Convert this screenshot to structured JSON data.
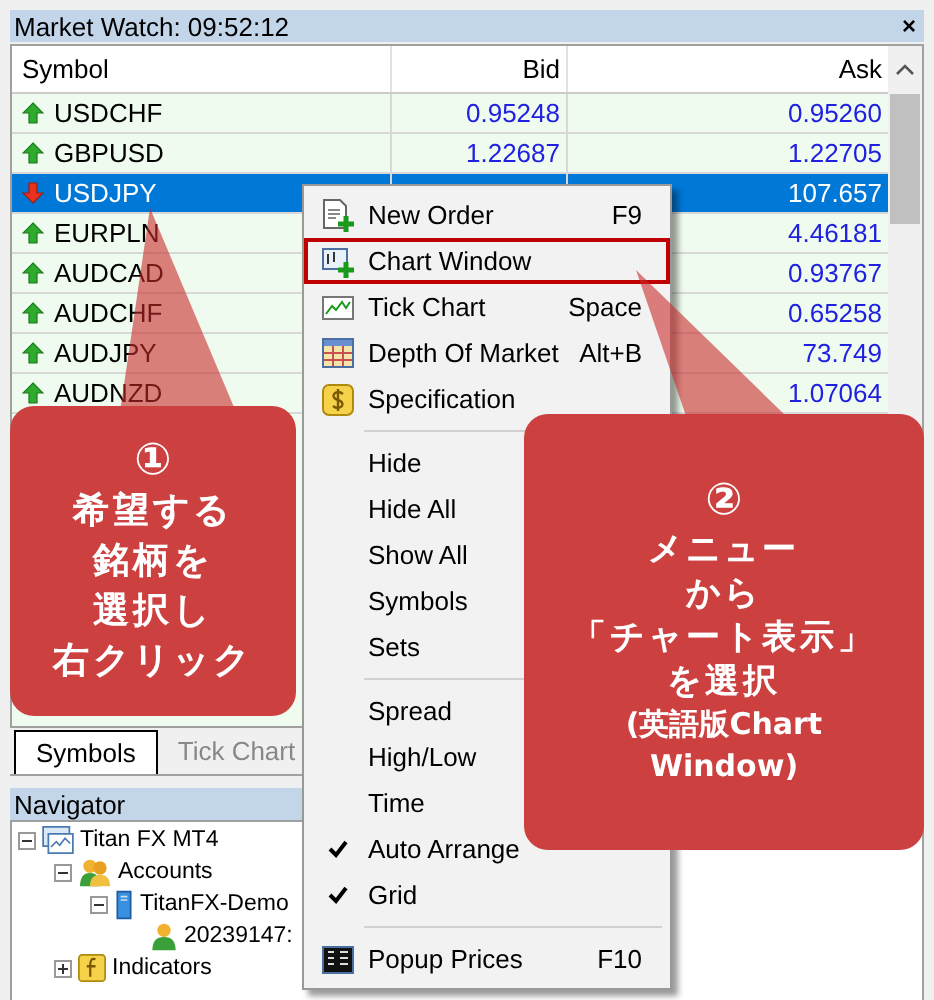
{
  "market_watch": {
    "title": "Market Watch: 09:52:12",
    "close": "×",
    "columns": [
      "Symbol",
      "Bid",
      "Ask"
    ],
    "rows": [
      {
        "symbol": "USDCHF",
        "kind": "up",
        "bid": "0.95248",
        "ask": "0.95260",
        "selected": false
      },
      {
        "symbol": "GBPUSD",
        "kind": "up",
        "bid": "1.22687",
        "ask": "1.22705",
        "selected": false
      },
      {
        "symbol": "USDJPY",
        "kind": "down",
        "ask": "107.657",
        "selected": true
      },
      {
        "symbol": "EURPLN",
        "kind": "up",
        "ask": "4.46181",
        "selected": false
      },
      {
        "symbol": "AUDCAD",
        "kind": "up",
        "ask": "0.93767",
        "selected": false
      },
      {
        "symbol": "AUDCHF",
        "kind": "up",
        "ask": "0.65258",
        "selected": false
      },
      {
        "symbol": "AUDJPY",
        "kind": "up",
        "ask": "73.749",
        "selected": false
      },
      {
        "symbol": "AUDNZD",
        "kind": "up",
        "ask": "1.07064",
        "selected": false
      }
    ],
    "tabs": [
      {
        "label": "Symbols",
        "selected": true
      },
      {
        "label": "Tick Chart",
        "selected": false
      }
    ]
  },
  "navigator": {
    "title": "Navigator",
    "tree": [
      {
        "label": "Titan FX MT4",
        "kind": "terminal",
        "expanded": true,
        "children": [
          {
            "label": "Accounts",
            "kind": "accounts",
            "expanded": true,
            "children": [
              {
                "label": "TitanFX-Demo",
                "kind": "server",
                "expanded": true,
                "children": [
                  {
                    "label": "20239147:",
                    "kind": "user"
                  }
                ]
              }
            ]
          },
          {
            "label": "Indicators",
            "kind": "indicators",
            "expanded": false
          }
        ]
      }
    ]
  },
  "context_menu": {
    "items": [
      {
        "kind": "item",
        "label": "New Order",
        "shortcut": "F9",
        "highlighted": false,
        "checked": false
      },
      {
        "kind": "item",
        "label": "Chart Window",
        "highlighted": true,
        "checked": false
      },
      {
        "kind": "item",
        "label": "Tick Chart",
        "shortcut": "Space",
        "highlighted": false,
        "checked": false
      },
      {
        "kind": "item",
        "label": "Depth Of Market",
        "shortcut": "Alt+B",
        "highlighted": false,
        "checked": false
      },
      {
        "kind": "item",
        "label": "Specification",
        "highlighted": false,
        "checked": false
      },
      {
        "kind": "separator"
      },
      {
        "kind": "item",
        "label": "Hide",
        "highlighted": false,
        "checked": false
      },
      {
        "kind": "item",
        "label": "Hide All",
        "highlighted": false,
        "checked": false
      },
      {
        "kind": "item",
        "label": "Show All",
        "highlighted": false,
        "checked": false
      },
      {
        "kind": "item",
        "label": "Symbols",
        "highlighted": false,
        "checked": false
      },
      {
        "kind": "item",
        "label": "Sets",
        "highlighted": false,
        "checked": false
      },
      {
        "kind": "separator"
      },
      {
        "kind": "item",
        "label": "Spread",
        "highlighted": false,
        "checked": false
      },
      {
        "kind": "item",
        "label": "High/Low",
        "highlighted": false,
        "checked": false
      },
      {
        "kind": "item",
        "label": "Time",
        "highlighted": false,
        "checked": false
      },
      {
        "kind": "item",
        "label": "Auto Arrange",
        "highlighted": false,
        "checked": true
      },
      {
        "kind": "item",
        "label": "Grid",
        "highlighted": false,
        "checked": true
      },
      {
        "kind": "separator"
      },
      {
        "kind": "item",
        "label": "Popup Prices",
        "shortcut": "F10",
        "highlighted": false,
        "checked": false
      }
    ]
  },
  "callouts": [
    {
      "number": "①",
      "lines": [
        "希望する",
        "銘柄を",
        "選択し",
        "右クリック"
      ]
    },
    {
      "number": "②",
      "lines": [
        "メニュー",
        "から",
        "「チャート表示」",
        "を選択"
      ],
      "note_lines": [
        "(英語版Chart",
        "Window)"
      ]
    }
  ]
}
